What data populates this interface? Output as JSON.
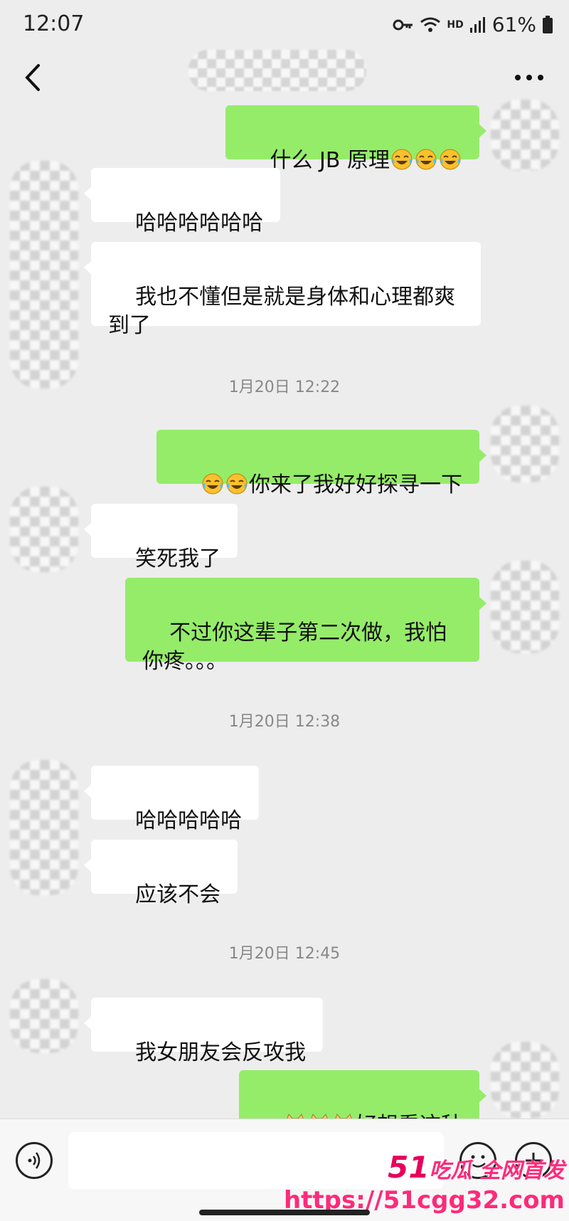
{
  "status_bar": {
    "time": "12:07",
    "network": "HD",
    "battery": "61%"
  },
  "nav": {
    "back_icon": "chevron-left-icon",
    "more_icon": "more-horizontal-icon"
  },
  "messages": {
    "m1": "什么 JB 原理",
    "m2": "哈哈哈哈哈哈",
    "m3": "我也不懂但是就是身体和心理都爽到了",
    "ts1": "1月20日 12:22",
    "m4": "你来了我好好探寻一下",
    "m5": "笑死我了",
    "m6": "不过你这辈子第二次做，我怕你疼。。。",
    "ts2": "1月20日 12:38",
    "m7": "哈哈哈哈哈",
    "m8": "应该不会",
    "ts3": "1月20日 12:45",
    "m9": "我女朋友会反攻我",
    "m10": "好想看这种"
  },
  "emojis": {
    "laugh_cry": "laugh-cry-emoji",
    "doge": "doge-emoji"
  },
  "input_bar": {
    "voice_icon": "voice-icon",
    "emoji_icon": "smiley-icon",
    "plus_icon": "plus-icon",
    "input_value": ""
  },
  "watermark": {
    "line1_num": "51",
    "line1_text": "吃瓜 全网首发",
    "line2": "https://51cgg32.com"
  },
  "colors": {
    "background": "#ededed",
    "sent_bubble": "#95ec69",
    "received_bubble": "#ffffff",
    "watermark": "#ff2a7a"
  }
}
